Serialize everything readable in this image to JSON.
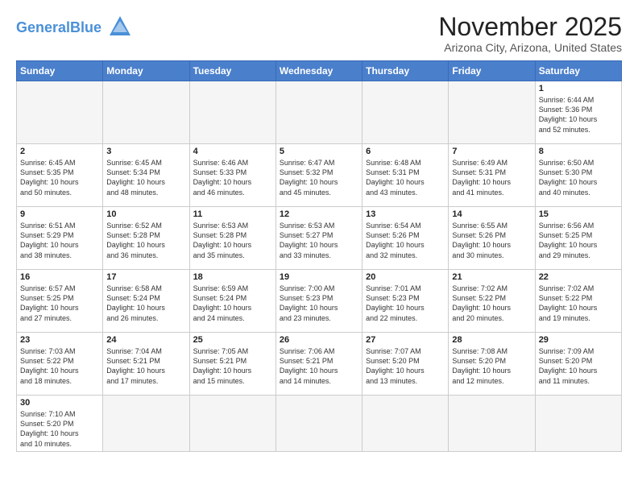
{
  "header": {
    "logo_general": "General",
    "logo_blue": "Blue",
    "month_title": "November 2025",
    "location": "Arizona City, Arizona, United States"
  },
  "days_of_week": [
    "Sunday",
    "Monday",
    "Tuesday",
    "Wednesday",
    "Thursday",
    "Friday",
    "Saturday"
  ],
  "weeks": [
    [
      {
        "day": "",
        "info": ""
      },
      {
        "day": "",
        "info": ""
      },
      {
        "day": "",
        "info": ""
      },
      {
        "day": "",
        "info": ""
      },
      {
        "day": "",
        "info": ""
      },
      {
        "day": "",
        "info": ""
      },
      {
        "day": "1",
        "info": "Sunrise: 6:44 AM\nSunset: 5:36 PM\nDaylight: 10 hours\nand 52 minutes."
      }
    ],
    [
      {
        "day": "2",
        "info": "Sunrise: 6:45 AM\nSunset: 5:35 PM\nDaylight: 10 hours\nand 50 minutes."
      },
      {
        "day": "3",
        "info": "Sunrise: 6:45 AM\nSunset: 5:34 PM\nDaylight: 10 hours\nand 48 minutes."
      },
      {
        "day": "4",
        "info": "Sunrise: 6:46 AM\nSunset: 5:33 PM\nDaylight: 10 hours\nand 46 minutes."
      },
      {
        "day": "5",
        "info": "Sunrise: 6:47 AM\nSunset: 5:32 PM\nDaylight: 10 hours\nand 45 minutes."
      },
      {
        "day": "6",
        "info": "Sunrise: 6:48 AM\nSunset: 5:31 PM\nDaylight: 10 hours\nand 43 minutes."
      },
      {
        "day": "7",
        "info": "Sunrise: 6:49 AM\nSunset: 5:31 PM\nDaylight: 10 hours\nand 41 minutes."
      },
      {
        "day": "8",
        "info": "Sunrise: 6:50 AM\nSunset: 5:30 PM\nDaylight: 10 hours\nand 40 minutes."
      }
    ],
    [
      {
        "day": "9",
        "info": "Sunrise: 6:51 AM\nSunset: 5:29 PM\nDaylight: 10 hours\nand 38 minutes."
      },
      {
        "day": "10",
        "info": "Sunrise: 6:52 AM\nSunset: 5:28 PM\nDaylight: 10 hours\nand 36 minutes."
      },
      {
        "day": "11",
        "info": "Sunrise: 6:53 AM\nSunset: 5:28 PM\nDaylight: 10 hours\nand 35 minutes."
      },
      {
        "day": "12",
        "info": "Sunrise: 6:53 AM\nSunset: 5:27 PM\nDaylight: 10 hours\nand 33 minutes."
      },
      {
        "day": "13",
        "info": "Sunrise: 6:54 AM\nSunset: 5:26 PM\nDaylight: 10 hours\nand 32 minutes."
      },
      {
        "day": "14",
        "info": "Sunrise: 6:55 AM\nSunset: 5:26 PM\nDaylight: 10 hours\nand 30 minutes."
      },
      {
        "day": "15",
        "info": "Sunrise: 6:56 AM\nSunset: 5:25 PM\nDaylight: 10 hours\nand 29 minutes."
      }
    ],
    [
      {
        "day": "16",
        "info": "Sunrise: 6:57 AM\nSunset: 5:25 PM\nDaylight: 10 hours\nand 27 minutes."
      },
      {
        "day": "17",
        "info": "Sunrise: 6:58 AM\nSunset: 5:24 PM\nDaylight: 10 hours\nand 26 minutes."
      },
      {
        "day": "18",
        "info": "Sunrise: 6:59 AM\nSunset: 5:24 PM\nDaylight: 10 hours\nand 24 minutes."
      },
      {
        "day": "19",
        "info": "Sunrise: 7:00 AM\nSunset: 5:23 PM\nDaylight: 10 hours\nand 23 minutes."
      },
      {
        "day": "20",
        "info": "Sunrise: 7:01 AM\nSunset: 5:23 PM\nDaylight: 10 hours\nand 22 minutes."
      },
      {
        "day": "21",
        "info": "Sunrise: 7:02 AM\nSunset: 5:22 PM\nDaylight: 10 hours\nand 20 minutes."
      },
      {
        "day": "22",
        "info": "Sunrise: 7:02 AM\nSunset: 5:22 PM\nDaylight: 10 hours\nand 19 minutes."
      }
    ],
    [
      {
        "day": "23",
        "info": "Sunrise: 7:03 AM\nSunset: 5:22 PM\nDaylight: 10 hours\nand 18 minutes."
      },
      {
        "day": "24",
        "info": "Sunrise: 7:04 AM\nSunset: 5:21 PM\nDaylight: 10 hours\nand 17 minutes."
      },
      {
        "day": "25",
        "info": "Sunrise: 7:05 AM\nSunset: 5:21 PM\nDaylight: 10 hours\nand 15 minutes."
      },
      {
        "day": "26",
        "info": "Sunrise: 7:06 AM\nSunset: 5:21 PM\nDaylight: 10 hours\nand 14 minutes."
      },
      {
        "day": "27",
        "info": "Sunrise: 7:07 AM\nSunset: 5:20 PM\nDaylight: 10 hours\nand 13 minutes."
      },
      {
        "day": "28",
        "info": "Sunrise: 7:08 AM\nSunset: 5:20 PM\nDaylight: 10 hours\nand 12 minutes."
      },
      {
        "day": "29",
        "info": "Sunrise: 7:09 AM\nSunset: 5:20 PM\nDaylight: 10 hours\nand 11 minutes."
      }
    ],
    [
      {
        "day": "30",
        "info": "Sunrise: 7:10 AM\nSunset: 5:20 PM\nDaylight: 10 hours\nand 10 minutes."
      },
      {
        "day": "",
        "info": ""
      },
      {
        "day": "",
        "info": ""
      },
      {
        "day": "",
        "info": ""
      },
      {
        "day": "",
        "info": ""
      },
      {
        "day": "",
        "info": ""
      },
      {
        "day": "",
        "info": ""
      }
    ]
  ]
}
